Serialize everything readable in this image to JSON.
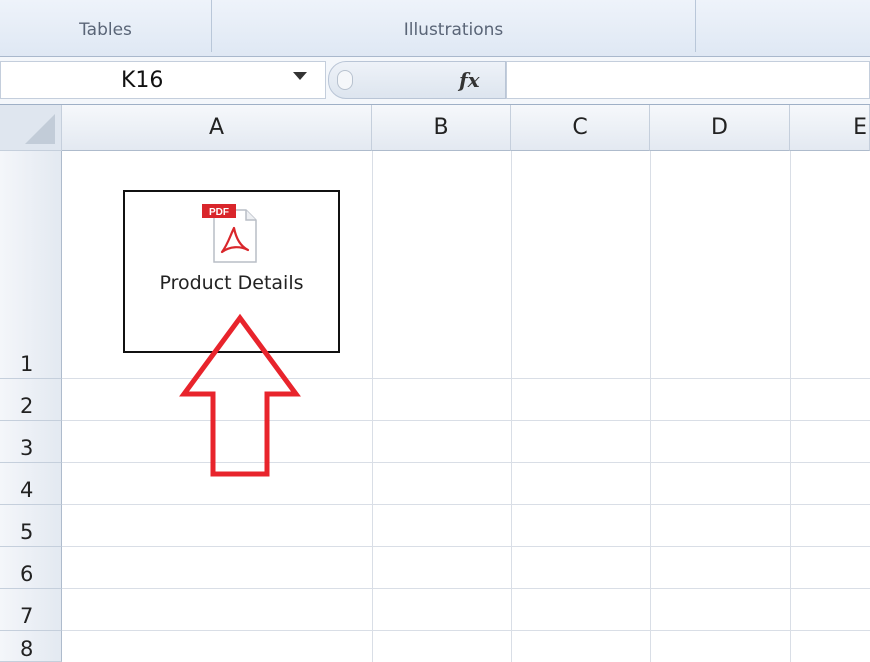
{
  "ribbon": {
    "groups": [
      "Tables",
      "Illustrations",
      ""
    ]
  },
  "formula_bar": {
    "name_box": "K16",
    "fx_label": "fx",
    "formula": ""
  },
  "sheet": {
    "columns": [
      "A",
      "B",
      "C",
      "D",
      "E"
    ],
    "rows": [
      "1",
      "2",
      "3",
      "4",
      "5",
      "6",
      "7",
      "8"
    ]
  },
  "embedded_object": {
    "badge": "PDF",
    "caption": "Product Details",
    "icon": "pdf-file-icon"
  },
  "annotation": {
    "icon": "up-arrow-icon",
    "color": "#e8242c"
  },
  "colors": {
    "header_bg": "#e3e9f1",
    "grid": "#d9dee6",
    "pdf_red": "#d9262b"
  }
}
